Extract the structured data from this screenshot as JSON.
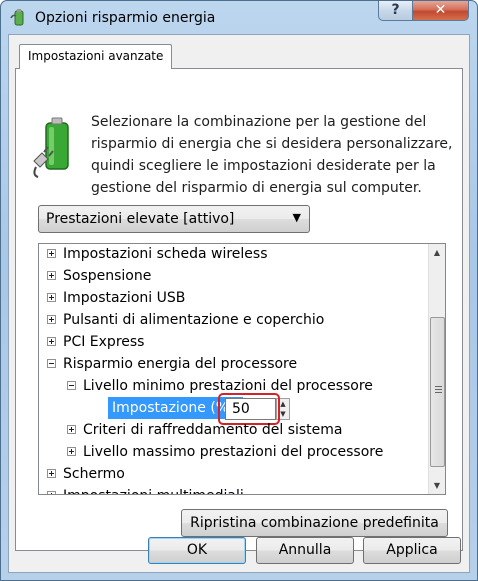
{
  "window": {
    "title": "Opzioni risparmio energia",
    "help_label": "?",
    "close_label": "✕"
  },
  "tab": {
    "label": "Impostazioni avanzate"
  },
  "description": "Selezionare la combinazione per la gestione del risparmio di energia che si desidera personalizzare, quindi scegliere le impostazioni desiderate per la gestione del risparmio di energia sul computer.",
  "plan_select": {
    "value": "Prestazioni elevate [attivo]",
    "arrow": "▼"
  },
  "tree": {
    "items": [
      {
        "label": "Impostazioni scheda wireless",
        "expanded": false
      },
      {
        "label": "Sospensione",
        "expanded": false
      },
      {
        "label": "Impostazioni USB",
        "expanded": false
      },
      {
        "label": "Pulsanti di alimentazione e coperchio",
        "expanded": false
      },
      {
        "label": "PCI Express",
        "expanded": false
      },
      {
        "label": "Risparmio energia del processore",
        "expanded": true
      },
      {
        "label": "Livello minimo prestazioni del processore",
        "expanded": true
      },
      {
        "label": "Criteri di raffreddamento del sistema",
        "expanded": false
      },
      {
        "label": "Livello massimo prestazioni del processore",
        "expanded": false
      },
      {
        "label": "Schermo",
        "expanded": false
      },
      {
        "label": "Impostazioni multimediali",
        "expanded": false
      }
    ],
    "setting": {
      "label": "Impostazione (%):",
      "value": "50"
    },
    "scroll": {
      "up": "▲",
      "down": "▼"
    }
  },
  "buttons": {
    "restore": "Ripristina combinazione predefinita",
    "ok": "OK",
    "cancel": "Annulla",
    "apply": "Applica"
  },
  "colors": {
    "selection": "#3399ff",
    "highlight_box": "#d2232a",
    "battery_green": "#3aa835"
  }
}
